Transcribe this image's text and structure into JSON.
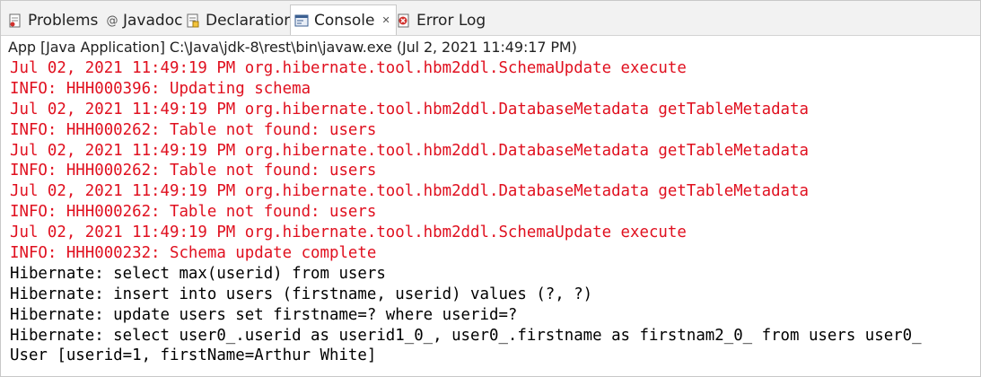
{
  "tabs": [
    {
      "label": "Problems",
      "icon": "problems-icon"
    },
    {
      "label": "Javadoc",
      "icon": "at-icon"
    },
    {
      "label": "Declaration",
      "icon": "declaration-icon"
    },
    {
      "label": "Console",
      "icon": "console-icon",
      "close": "✕"
    },
    {
      "label": "Error Log",
      "icon": "error-log-icon"
    }
  ],
  "launch_title": "App [Java Application] C:\\Java\\jdk-8\\rest\\bin\\javaw.exe  (Jul 2, 2021 11:49:17 PM)",
  "colors": {
    "stderr": "#e0101f",
    "stdout": "#000000"
  },
  "console_lines": [
    {
      "text": "Jul 02, 2021 11:49:19 PM org.hibernate.tool.hbm2ddl.SchemaUpdate execute",
      "stream": "stderr"
    },
    {
      "text": "INFO: HHH000396: Updating schema",
      "stream": "stderr"
    },
    {
      "text": "Jul 02, 2021 11:49:19 PM org.hibernate.tool.hbm2ddl.DatabaseMetadata getTableMetadata",
      "stream": "stderr"
    },
    {
      "text": "INFO: HHH000262: Table not found: users",
      "stream": "stderr"
    },
    {
      "text": "Jul 02, 2021 11:49:19 PM org.hibernate.tool.hbm2ddl.DatabaseMetadata getTableMetadata",
      "stream": "stderr"
    },
    {
      "text": "INFO: HHH000262: Table not found: users",
      "stream": "stderr"
    },
    {
      "text": "Jul 02, 2021 11:49:19 PM org.hibernate.tool.hbm2ddl.DatabaseMetadata getTableMetadata",
      "stream": "stderr"
    },
    {
      "text": "INFO: HHH000262: Table not found: users",
      "stream": "stderr"
    },
    {
      "text": "Jul 02, 2021 11:49:19 PM org.hibernate.tool.hbm2ddl.SchemaUpdate execute",
      "stream": "stderr"
    },
    {
      "text": "INFO: HHH000232: Schema update complete",
      "stream": "stderr"
    },
    {
      "text": "Hibernate: select max(userid) from users",
      "stream": "stdout"
    },
    {
      "text": "Hibernate: insert into users (firstname, userid) values (?, ?)",
      "stream": "stdout"
    },
    {
      "text": "Hibernate: update users set firstname=? where userid=?",
      "stream": "stdout"
    },
    {
      "text": "Hibernate: select user0_.userid as userid1_0_, user0_.firstname as firstnam2_0_ from users user0_",
      "stream": "stdout"
    },
    {
      "text": "User [userid=1, firstName=Arthur White]",
      "stream": "stdout"
    }
  ]
}
